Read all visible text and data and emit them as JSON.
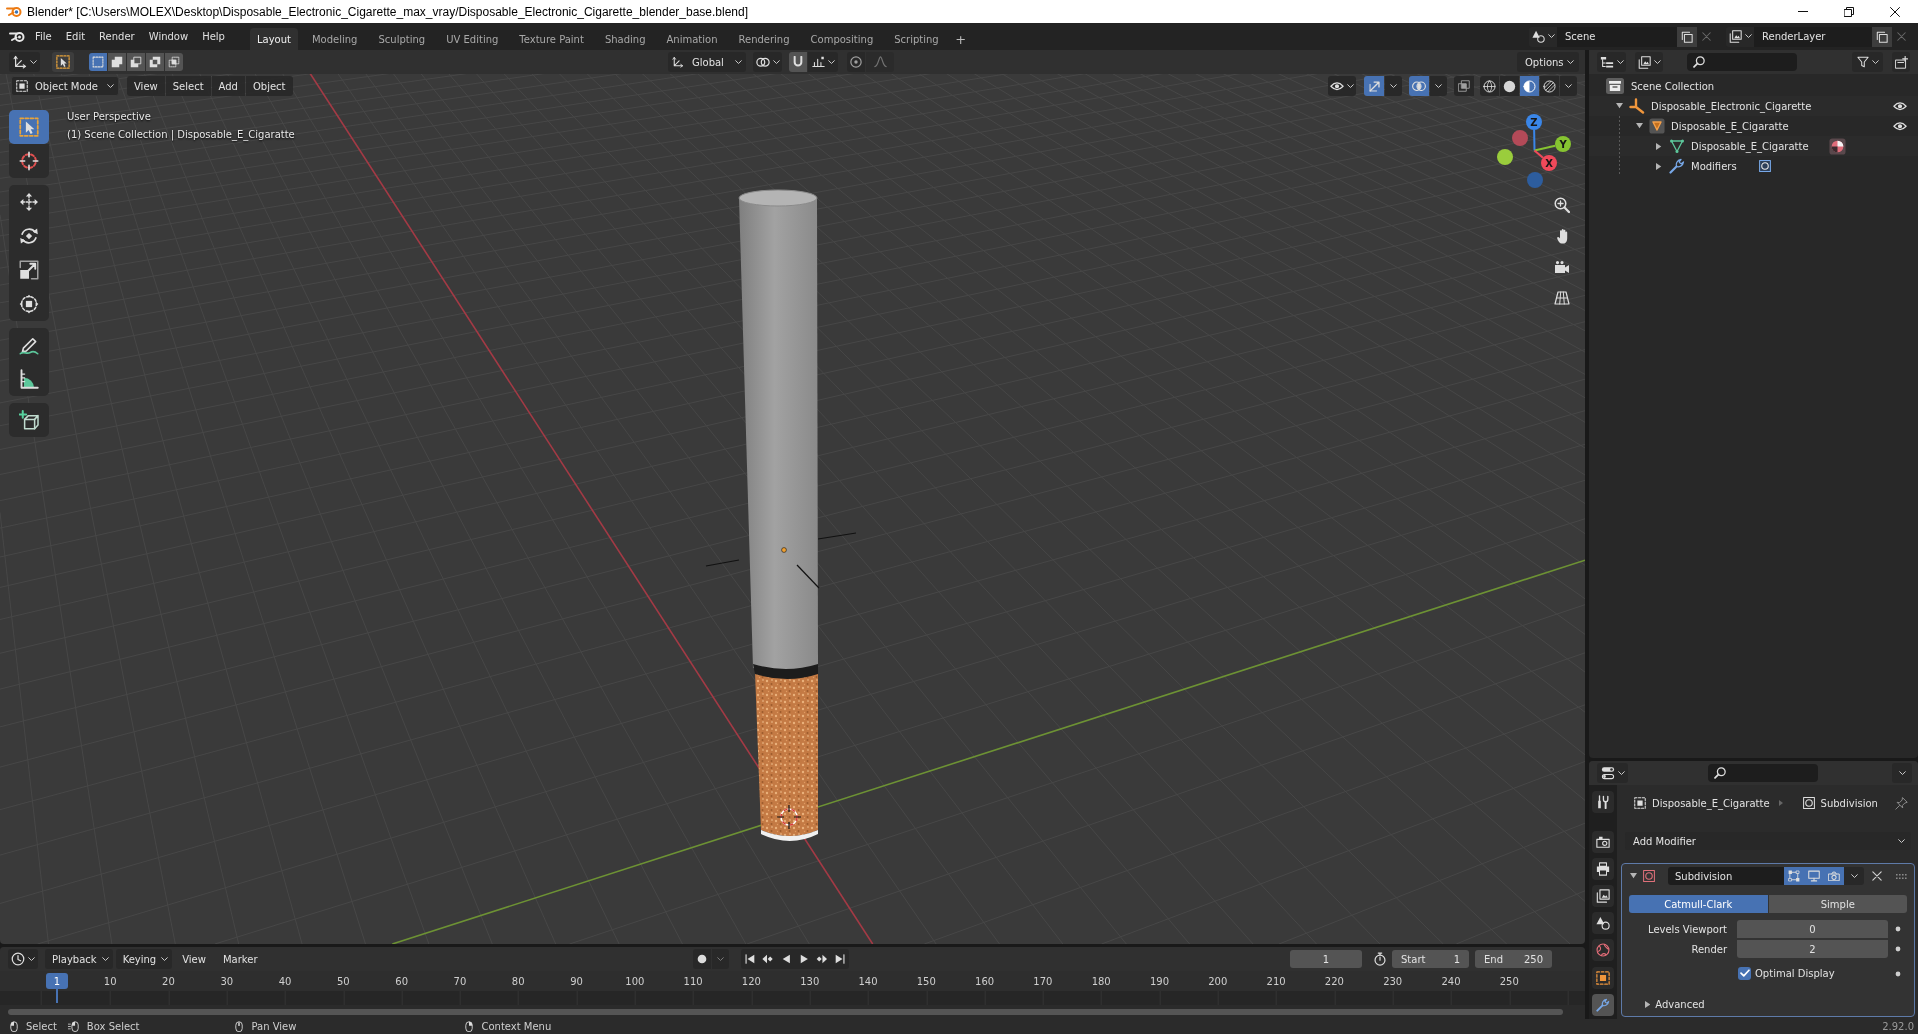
{
  "window": {
    "title": "Blender* [C:\\Users\\MOLEX\\Desktop\\Disposable_Electronic_Cigarette_max_vray/Disposable_Electronic_Cigarette_blender_base.blend]"
  },
  "menu": [
    "File",
    "Edit",
    "Render",
    "Window",
    "Help"
  ],
  "workspaces": [
    {
      "label": "Layout",
      "selected": true
    },
    {
      "label": "Modeling",
      "selected": false
    },
    {
      "label": "Sculpting",
      "selected": false
    },
    {
      "label": "UV Editing",
      "selected": false
    },
    {
      "label": "Texture Paint",
      "selected": false
    },
    {
      "label": "Shading",
      "selected": false
    },
    {
      "label": "Animation",
      "selected": false
    },
    {
      "label": "Rendering",
      "selected": false
    },
    {
      "label": "Compositing",
      "selected": false
    },
    {
      "label": "Scripting",
      "selected": false
    }
  ],
  "add_workspace": "+",
  "scene": "Scene",
  "view_layer": "RenderLayer",
  "tool_settings": {
    "select_modes": [
      {
        "kind": "set",
        "selected": true
      },
      {
        "kind": "extend",
        "selected": false
      },
      {
        "kind": "subtract",
        "selected": false
      },
      {
        "kind": "invert",
        "selected": false
      },
      {
        "kind": "intersect",
        "selected": false
      }
    ],
    "orientation": "Global",
    "options": "Options"
  },
  "viewport": {
    "mode": "Object Mode",
    "menus": [
      "View",
      "Select",
      "Add",
      "Object"
    ],
    "gizmos": true,
    "overlays": true,
    "xray": false,
    "shading": [
      {
        "kind": "wireframe",
        "selected": false
      },
      {
        "kind": "solid",
        "selected": false
      },
      {
        "kind": "material",
        "selected": true
      },
      {
        "kind": "rendered",
        "selected": false
      }
    ],
    "info": [
      "User Perspective",
      "(1) Scene Collection | Disposable_E_Cigaratte"
    ],
    "tools": [
      {
        "kind": "select_box",
        "selected": true
      },
      {
        "kind": "cursor",
        "selected": false
      },
      {
        "kind": "move",
        "selected": false
      },
      {
        "kind": "rotate",
        "selected": false
      },
      {
        "kind": "scale",
        "selected": false
      },
      {
        "kind": "transform",
        "selected": false
      },
      {
        "kind": "annotate",
        "selected": false
      },
      {
        "kind": "measure",
        "selected": false
      },
      {
        "kind": "add_cube",
        "selected": false
      }
    ],
    "gizmo_axes": [
      {
        "kind": "negative_x",
        "color": "#b34a58"
      },
      {
        "kind": "negative_y",
        "color": "#9acd3c"
      },
      {
        "kind": "negative_z",
        "color": "#2d5d9e"
      },
      {
        "kind": "positive_z",
        "label": "Z",
        "color": "#3a86e8"
      },
      {
        "kind": "positive_y",
        "label": "Y",
        "color": "#86c431"
      },
      {
        "kind": "positive_x",
        "label": "X",
        "color": "#f0495a"
      }
    ]
  },
  "outliner": {
    "items": [
      {
        "label": "Scene Collection",
        "kind": "collection",
        "children": [
          {
            "label": "Disposable_Electronic_Cigarette",
            "kind": "empty",
            "expanded": true,
            "visible": true,
            "children": [
              {
                "label": "Disposable_E_Cigaratte",
                "kind": "object",
                "expanded": true,
                "visible": true,
                "children": [
                  {
                    "label": "Disposable_E_Cigaratte",
                    "kind": "mesh",
                    "expanded": false,
                    "badge": {
                      "kind": "material"
                    }
                  },
                  {
                    "label": "Modifiers",
                    "kind": "modifiers",
                    "expanded": false,
                    "badge": {
                      "kind": "subdivision"
                    }
                  }
                ]
              }
            ]
          }
        ]
      }
    ]
  },
  "properties": {
    "tabs": [
      {
        "kind": "tool",
        "selected": false
      },
      {
        "kind": "render",
        "selected": false
      },
      {
        "kind": "output",
        "selected": false
      },
      {
        "kind": "view_layer",
        "selected": false
      },
      {
        "kind": "scene",
        "selected": false
      },
      {
        "kind": "world",
        "selected": false
      },
      {
        "kind": "object",
        "selected": false
      },
      {
        "kind": "modifiers",
        "selected": true
      }
    ],
    "breadcrumb": [
      {
        "label": "Disposable_E_Cigaratte",
        "kind": "object"
      },
      {
        "label": "Subdivision",
        "kind": "modifier"
      }
    ],
    "add_modifier": "Add Modifier",
    "modifier": {
      "name": "Subdivision",
      "expanded": true,
      "edit_mode": true,
      "viewport": true,
      "render": true,
      "types": [
        {
          "label": "Catmull-Clark",
          "selected": true
        },
        {
          "label": "Simple",
          "selected": false
        }
      ],
      "fields": [
        {
          "label": "Levels Viewport",
          "value": "0"
        },
        {
          "label": "Render",
          "value": "2"
        }
      ],
      "optimal_display": {
        "label": "Optimal Display",
        "checked": true
      },
      "advanced": {
        "label": "Advanced",
        "expanded": false
      }
    }
  },
  "timeline": {
    "menus": [
      {
        "label": "Playback",
        "kind": "dropdown"
      },
      {
        "label": "Keying",
        "kind": "dropdown"
      },
      {
        "label": "View",
        "kind": "menu"
      },
      {
        "label": "Marker",
        "kind": "menu"
      }
    ],
    "current_frame": "1",
    "start": {
      "label": "Start",
      "value": "1"
    },
    "end": {
      "label": "End",
      "value": "250"
    },
    "ruler": {
      "current": "1",
      "labels": [
        "10",
        "20",
        "30",
        "40",
        "50",
        "60",
        "70",
        "80",
        "90",
        "100",
        "110",
        "120",
        "130",
        "140",
        "150",
        "160",
        "170",
        "180",
        "190",
        "200",
        "210",
        "220",
        "230",
        "240",
        "250"
      ]
    }
  },
  "status_bar": {
    "hints": [
      {
        "label": "Select",
        "kind": "left"
      },
      {
        "label": "Box Select",
        "kind": "drag"
      },
      {
        "label": "Pan View",
        "kind": "middle"
      },
      {
        "label": "Context Menu",
        "kind": "right"
      }
    ],
    "version": "2.92.0"
  }
}
